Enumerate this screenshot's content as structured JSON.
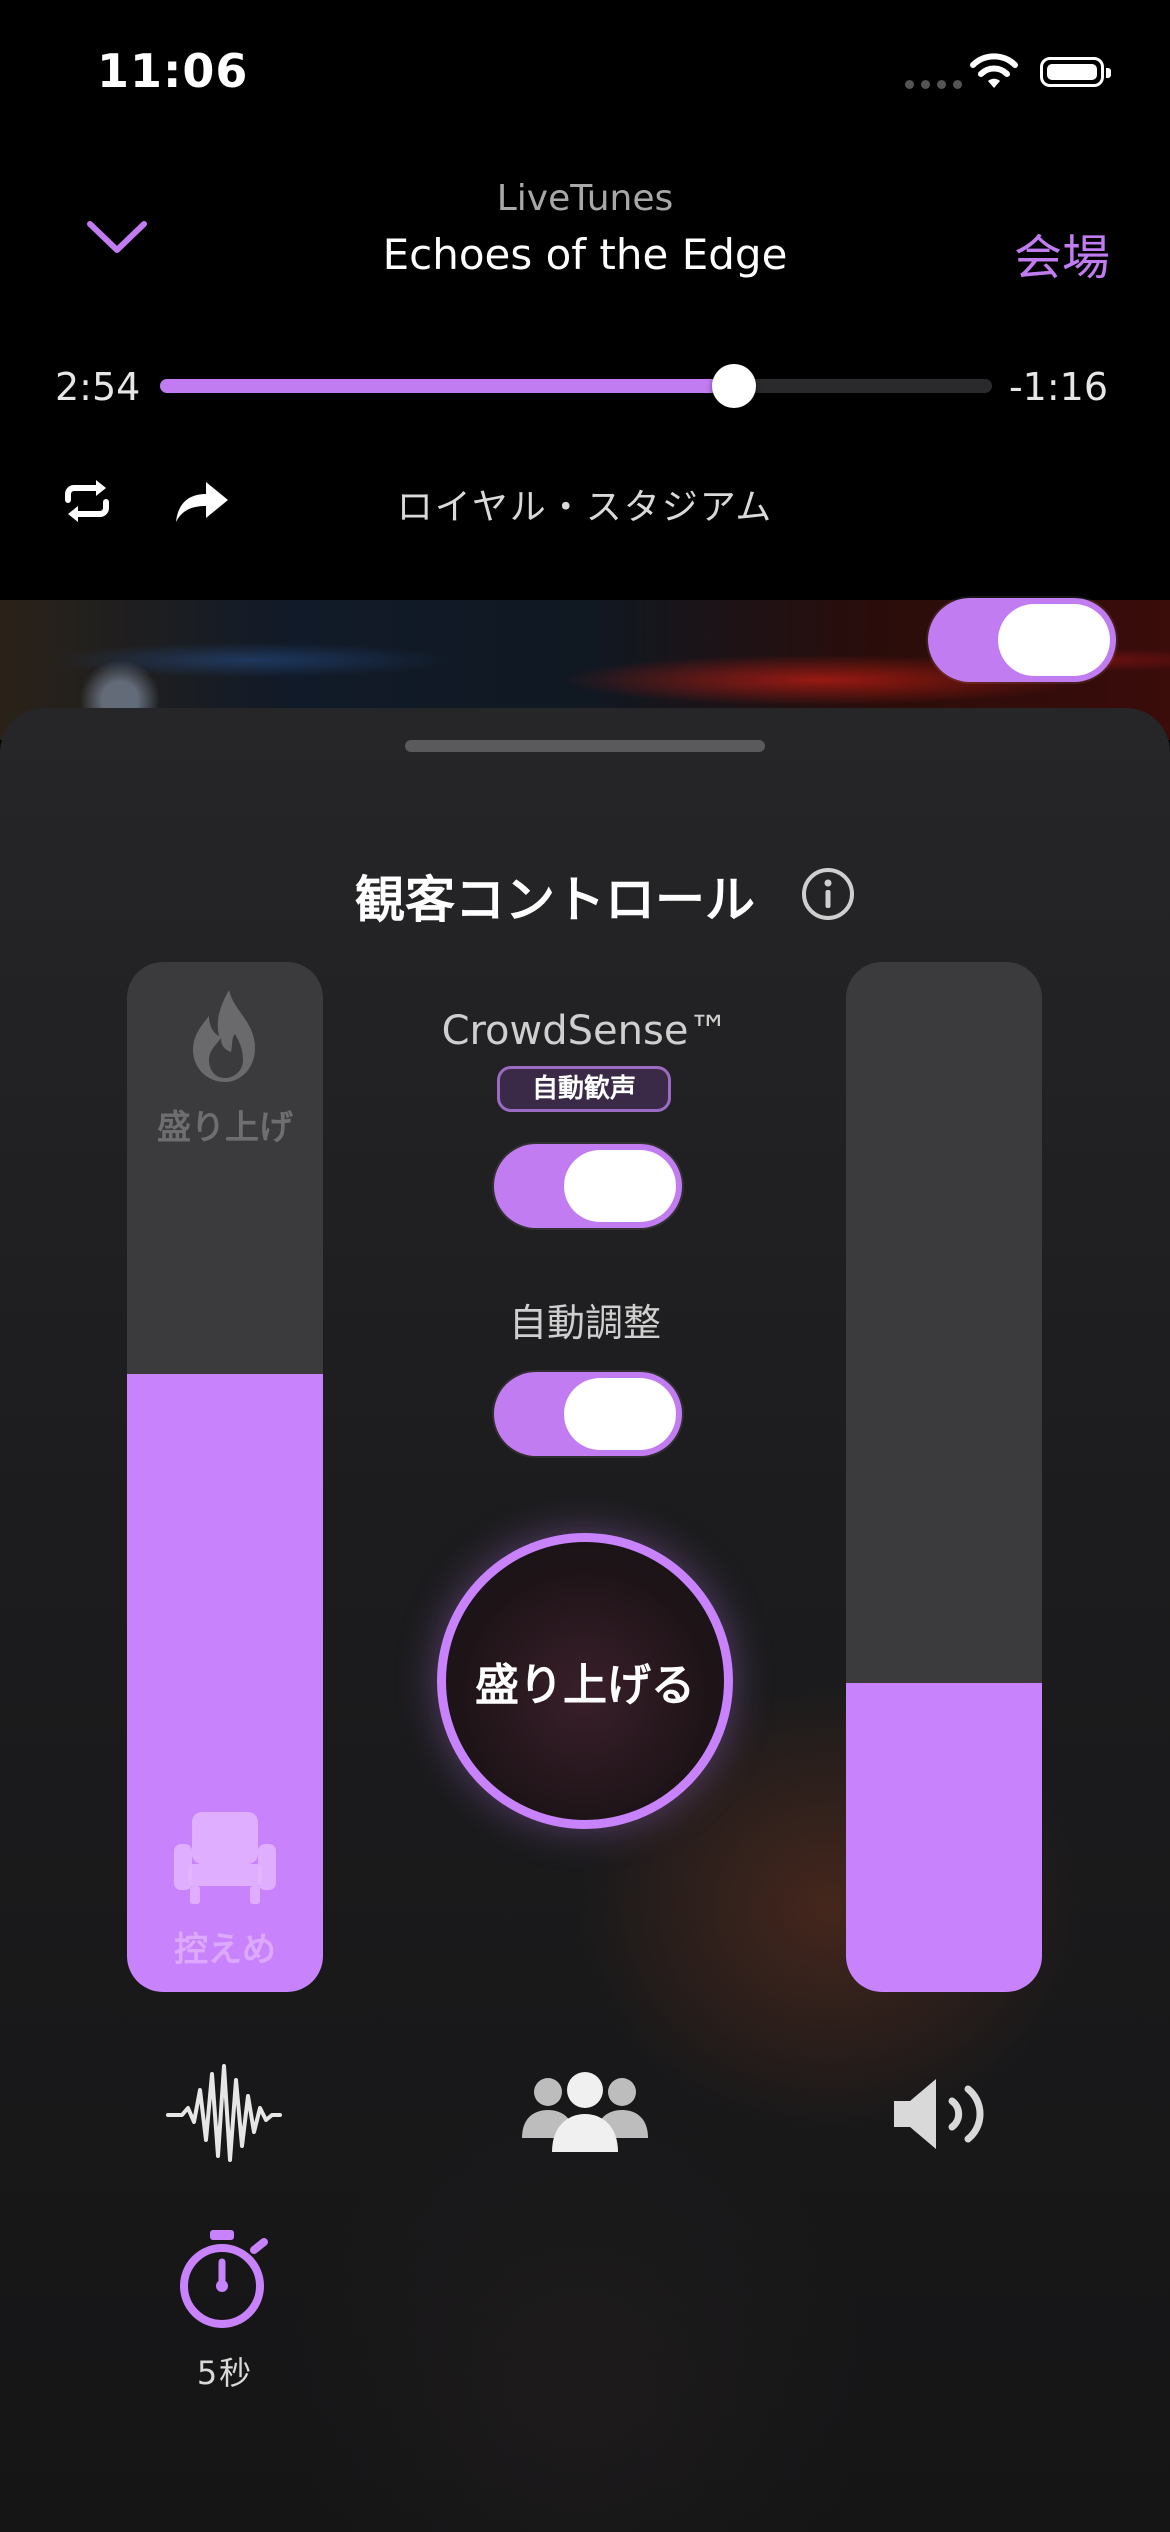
{
  "status_bar": {
    "time": "11:06"
  },
  "header": {
    "app_name": "LiveTunes",
    "track_title": "Echoes of the Edge",
    "venue_link": "会場"
  },
  "playback": {
    "elapsed": "2:54",
    "remaining": "-1:16",
    "progress_fraction": 0.69,
    "venue_name": "ロイヤル・スタジアム"
  },
  "panel": {
    "title": "観客コントロール",
    "hype_slider": {
      "top_label": "盛り上げ",
      "bottom_label": "控えめ",
      "level": 0.6
    },
    "volume_slider": {
      "level": 0.3
    },
    "crowdsense": {
      "label": "CrowdSense™",
      "badge": "自動歓声",
      "enabled": true
    },
    "auto_adjust": {
      "label": "自動調整",
      "enabled": true
    },
    "hype_button": "盛り上げる",
    "timer_label": "5秒"
  },
  "banner_toggle": {
    "enabled": true
  },
  "colors": {
    "accent": "#c27cf2",
    "slider_fill": "#c882fc",
    "background": "#000000",
    "sheet": "#1c1c1e"
  },
  "icons": [
    "chevron-down-icon",
    "repeat-icon",
    "share-icon",
    "info-icon",
    "flame-icon",
    "seat-icon",
    "waveform-icon",
    "crowd-icon",
    "speaker-icon",
    "timer-icon",
    "wifi-icon",
    "battery-icon"
  ]
}
